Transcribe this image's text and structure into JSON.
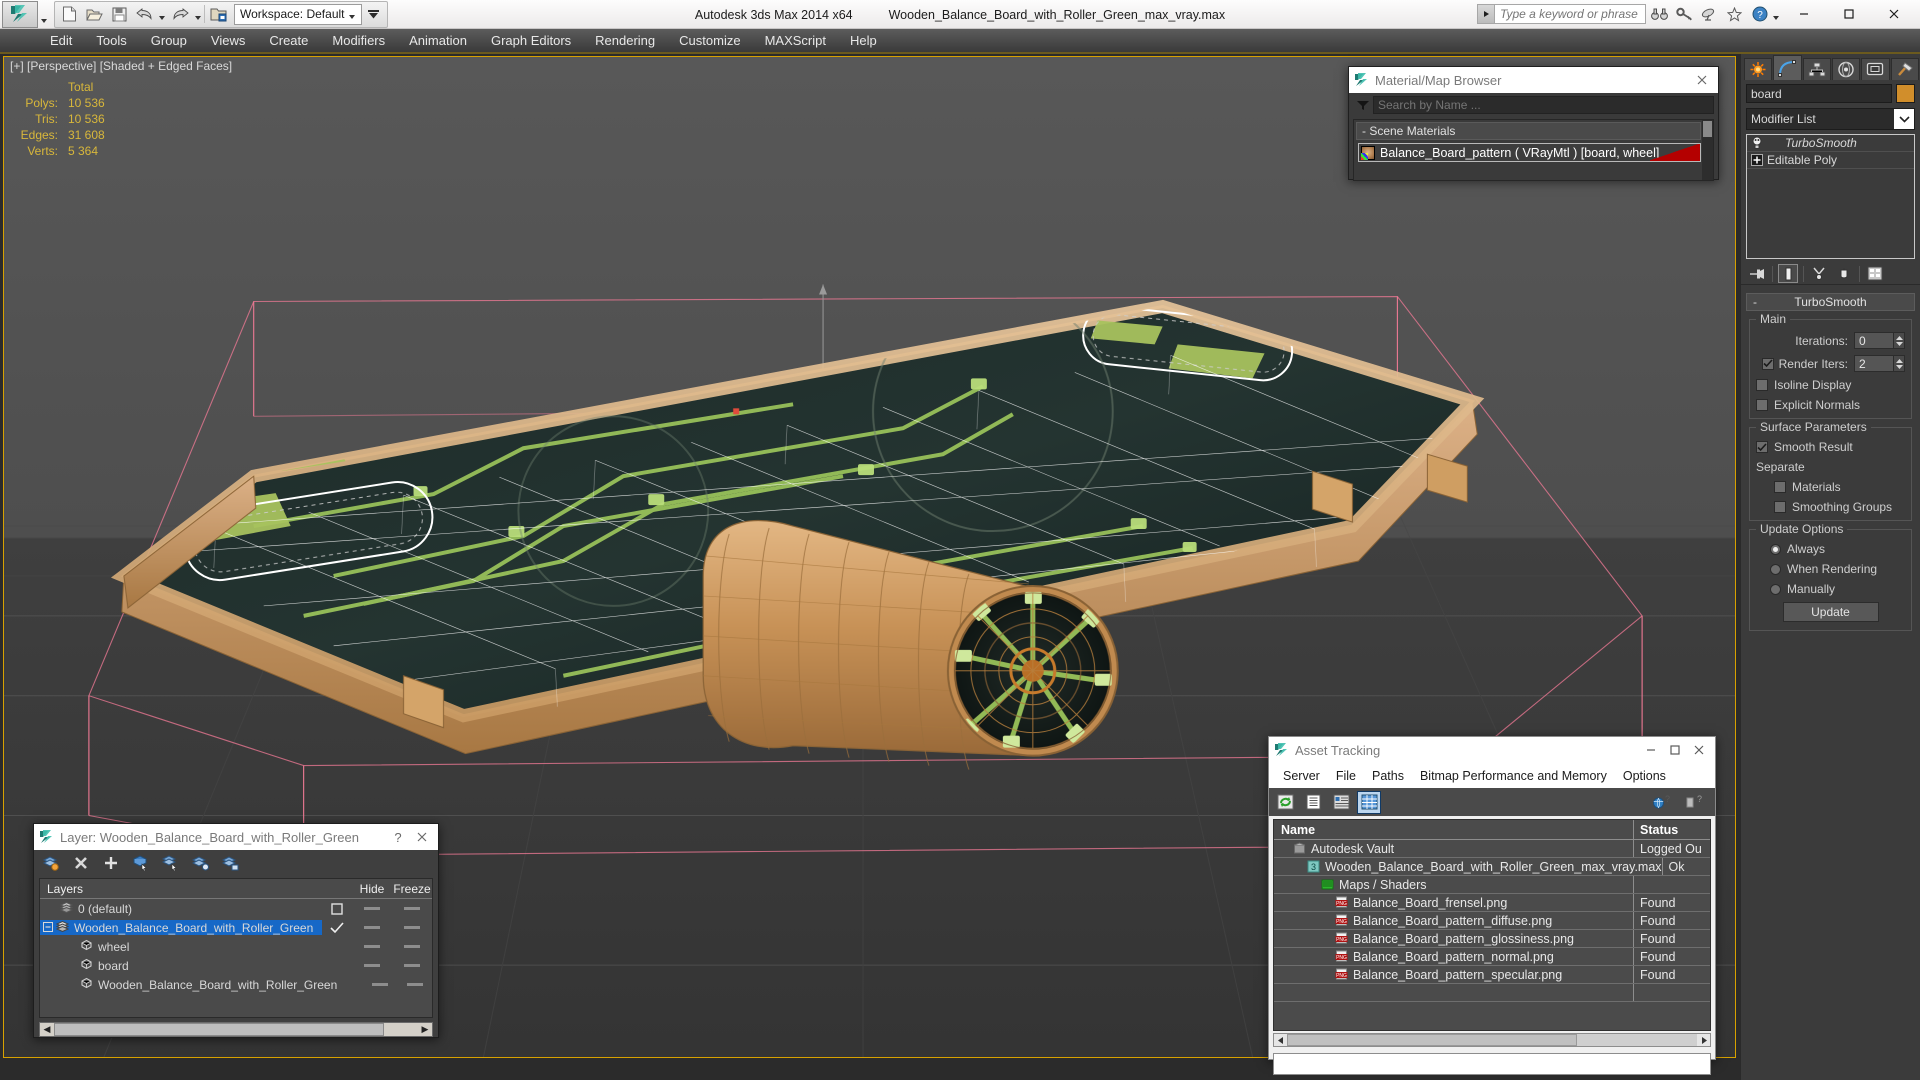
{
  "window": {
    "app_title": "Autodesk 3ds Max  2014 x64",
    "file_title": "Wooden_Balance_Board_with_Roller_Green_max_vray.max",
    "workspace_label": "Workspace: Default",
    "minimize": "–",
    "maximize": "❑",
    "close": "✕"
  },
  "search": {
    "placeholder": "Type a keyword or phrase"
  },
  "quick_access": [
    {
      "name": "new-file-icon"
    },
    {
      "name": "open-file-icon"
    },
    {
      "name": "save-file-icon"
    },
    {
      "name": "undo-icon"
    },
    {
      "name": "redo-icon"
    },
    {
      "name": "set-project-folder-icon"
    }
  ],
  "help_icons": [
    {
      "name": "binoculars-icon"
    },
    {
      "name": "key-icon"
    },
    {
      "name": "satellite-dish-icon"
    },
    {
      "name": "star-icon"
    },
    {
      "name": "help-icon"
    }
  ],
  "menubar": [
    "Edit",
    "Tools",
    "Group",
    "Views",
    "Create",
    "Modifiers",
    "Animation",
    "Graph Editors",
    "Rendering",
    "Customize",
    "MAXScript",
    "Help"
  ],
  "viewport": {
    "label": "[+] [Perspective] [Shaded + Edged Faces]",
    "stats_header": "Total",
    "stats": [
      {
        "label": "Polys:",
        "value": "10 536"
      },
      {
        "label": "Tris:",
        "value": "10 536"
      },
      {
        "label": "Edges:",
        "value": "31 608"
      },
      {
        "label": "Verts:",
        "value": "5 364"
      }
    ]
  },
  "material_browser": {
    "title": "Material/Map Browser",
    "search_placeholder": "Search by Name ...",
    "group_label": "- Scene Materials",
    "item_label": "Balance_Board_pattern  ( VRayMtl )  [board, wheel]",
    "close": "✕"
  },
  "asset_tracking": {
    "title": "Asset Tracking",
    "minimize": "—",
    "maximize": "☐",
    "close": "✕",
    "menu": [
      "Server",
      "File",
      "Paths",
      "Bitmap Performance and Memory",
      "Options"
    ],
    "toolbar": [
      {
        "name": "refresh-icon",
        "selected": false
      },
      {
        "name": "list-view-icon",
        "selected": false
      },
      {
        "name": "detail-view-icon",
        "selected": false
      },
      {
        "name": "table-view-icon",
        "selected": true
      }
    ],
    "toolbar_right": [
      {
        "name": "help-globe-icon"
      },
      {
        "name": "help-question-icon"
      }
    ],
    "columns": [
      "Name",
      "Status"
    ],
    "rows": [
      {
        "icon": "vault-icon",
        "indent": 1,
        "name": "Autodesk Vault",
        "status": "Logged Ou"
      },
      {
        "icon": "max-file-icon",
        "indent": 2,
        "name": "Wooden_Balance_Board_with_Roller_Green_max_vray.max",
        "status": "Ok"
      },
      {
        "icon": "maps-shaders-icon",
        "indent": 3,
        "name": "Maps / Shaders",
        "status": ""
      },
      {
        "icon": "png-icon",
        "indent": 4,
        "name": "Balance_Board_frensel.png",
        "status": "Found"
      },
      {
        "icon": "png-icon",
        "indent": 4,
        "name": "Balance_Board_pattern_diffuse.png",
        "status": "Found"
      },
      {
        "icon": "png-icon",
        "indent": 4,
        "name": "Balance_Board_pattern_glossiness.png",
        "status": "Found"
      },
      {
        "icon": "png-icon",
        "indent": 4,
        "name": "Balance_Board_pattern_normal.png",
        "status": "Found"
      },
      {
        "icon": "png-icon",
        "indent": 4,
        "name": "Balance_Board_pattern_specular.png",
        "status": "Found"
      },
      {
        "icon": "",
        "indent": 1,
        "name": "",
        "status": ""
      }
    ]
  },
  "layer_dialog": {
    "title": "Layer: Wooden_Balance_Board_with_Roller_Green",
    "help": "?",
    "close": "✕",
    "toolbar": [
      {
        "name": "create-new-layer-icon"
      },
      {
        "name": "delete-layer-icon"
      },
      {
        "name": "add-selection-to-layer-icon"
      },
      {
        "name": "select-objects-in-layer-icon"
      },
      {
        "name": "select-highlighted-objects-icon"
      },
      {
        "name": "highlight-selected-objects-icon"
      },
      {
        "name": "hide-unhide-layer-icon"
      }
    ],
    "columns": {
      "layers": "Layers",
      "hide": "Hide",
      "freeze": "Freeze"
    },
    "rows": [
      {
        "name": "0 (default)",
        "icon": "layer-icon",
        "indent": 1,
        "selected": false,
        "current": false,
        "expandable": false
      },
      {
        "name": "Wooden_Balance_Board_with_Roller_Green",
        "icon": "layer-icon",
        "indent": 0,
        "selected": true,
        "current": true,
        "expandable": true
      },
      {
        "name": "wheel",
        "icon": "object-icon",
        "indent": 2,
        "selected": false,
        "current": false,
        "expandable": false
      },
      {
        "name": "board",
        "icon": "object-icon",
        "indent": 2,
        "selected": false,
        "current": false,
        "expandable": false
      },
      {
        "name": "Wooden_Balance_Board_with_Roller_Green",
        "icon": "object-icon",
        "indent": 2,
        "selected": false,
        "current": false,
        "expandable": false
      }
    ]
  },
  "command_panel": {
    "tabs": [
      {
        "name": "create-tab",
        "icon": "star-burst-icon",
        "active": false
      },
      {
        "name": "modify-tab",
        "icon": "curve-icon",
        "active": true
      },
      {
        "name": "hierarchy-tab",
        "icon": "hierarchy-icon",
        "active": false
      },
      {
        "name": "motion-tab",
        "icon": "motion-wheel-icon",
        "active": false
      },
      {
        "name": "display-tab",
        "icon": "display-monitor-icon",
        "active": false
      },
      {
        "name": "utilities-tab",
        "icon": "hammer-icon",
        "active": false
      }
    ],
    "object_name": "board",
    "object_color": "#d18e2b",
    "modifier_list_label": "Modifier List",
    "stack": [
      {
        "label": "TurboSmooth",
        "icon": "lightbulb-icon",
        "italic": true
      },
      {
        "label": "Editable Poly",
        "icon": "plus-box-icon",
        "italic": false
      }
    ],
    "stack_buttons": [
      {
        "name": "pin-stack-icon",
        "on": false
      },
      {
        "name": "show-end-result-icon",
        "on": true
      },
      {
        "name": "make-unique-icon",
        "on": false
      },
      {
        "name": "remove-modifier-icon",
        "on": false
      },
      {
        "name": "configure-modifier-sets-icon",
        "on": false
      }
    ],
    "rollout": {
      "title": "TurboSmooth",
      "minus": "-",
      "groups": [
        {
          "title": "Main",
          "rows": [
            {
              "type": "spinner",
              "label": "Iterations:",
              "value": "0",
              "checkbox": null
            },
            {
              "type": "spinner",
              "label": "Render Iters:",
              "value": "2",
              "checkbox": true
            },
            {
              "type": "checkbox",
              "label": "Isoline Display",
              "checked": false
            },
            {
              "type": "checkbox",
              "label": "Explicit Normals",
              "checked": false
            }
          ]
        },
        {
          "title": "Surface Parameters",
          "rows": [
            {
              "type": "checkbox",
              "label": "Smooth Result",
              "checked": true
            },
            {
              "type": "text",
              "label": "Separate"
            },
            {
              "type": "checkbox",
              "label": "Materials",
              "checked": false,
              "indent": true
            },
            {
              "type": "checkbox",
              "label": "Smoothing Groups",
              "checked": false,
              "indent": true
            }
          ]
        },
        {
          "title": "Update Options",
          "rows": [
            {
              "type": "radio",
              "label": "Always",
              "checked": true
            },
            {
              "type": "radio",
              "label": "When Rendering",
              "checked": false
            },
            {
              "type": "radio",
              "label": "Manually",
              "checked": false
            },
            {
              "type": "button",
              "label": "Update"
            }
          ]
        }
      ]
    }
  },
  "colors": {
    "accent_gold": "#d8b73b",
    "selection_blue": "#1668c7",
    "pink_gizmo": "#f07a95",
    "wood": "#d9a86a",
    "board_green": "#a8c25e",
    "viewport_bg_top": "#585858",
    "viewport_bg_bottom": "#343434"
  }
}
